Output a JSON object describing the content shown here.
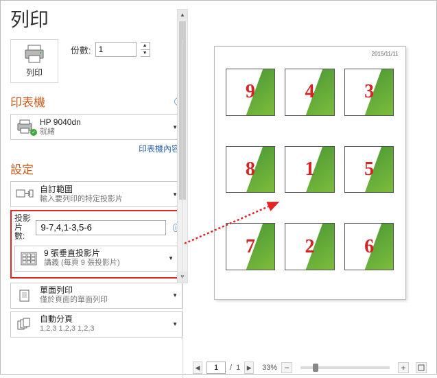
{
  "title": "列印",
  "print_button_label": "列印",
  "copies": {
    "label": "份數:",
    "value": "1"
  },
  "printer_section": {
    "heading": "印表機",
    "name": "HP 9040dn",
    "status": "就緒",
    "props_link": "印表機內容"
  },
  "settings": {
    "heading": "設定",
    "range": {
      "title": "自訂範圍",
      "subtitle": "輸入要列印的特定投影片"
    },
    "slides_label": "投影片數:",
    "slides_value": "9-7,4,1-3,5-6",
    "layout": {
      "title": "9 張垂直投影片",
      "subtitle": "講義 (每頁 9 張投影片)"
    },
    "sides": {
      "title": "單面列印",
      "subtitle": "僅於頁面的單面列印"
    },
    "collate": {
      "title": "自動分頁",
      "subtitle": "1,2,3   1,2,3   1,2,3"
    }
  },
  "preview": {
    "date": "2015/11/11",
    "slide_numbers": [
      "9",
      "4",
      "3",
      "8",
      "1",
      "5",
      "7",
      "2",
      "6"
    ],
    "page_current": "1",
    "page_total": "1",
    "zoom_pct": "33%"
  }
}
